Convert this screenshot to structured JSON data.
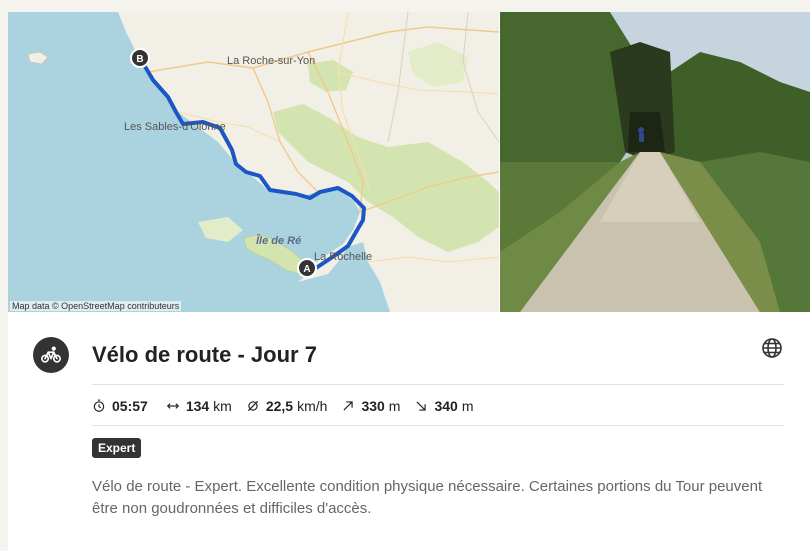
{
  "map": {
    "attribution": "Map data © OpenStreetMap contributeurs",
    "labels": {
      "city_north": "La Roche-sur-Yon",
      "city_west": "Les Sables-d'Olonne",
      "city_south": "La Rochelle",
      "island": "Île de Ré"
    },
    "markers": {
      "start": "A",
      "end": "B"
    }
  },
  "activity": {
    "title": "Vélo de route - Jour 7",
    "icon": "road-bike-icon"
  },
  "stats": {
    "duration": "05:57",
    "distance_value": "134",
    "distance_unit": "km",
    "speed_value": "22,5",
    "speed_unit": "km/h",
    "elevation_up_value": "330",
    "elevation_up_unit": "m",
    "elevation_down_value": "340",
    "elevation_down_unit": "m"
  },
  "badge": "Expert",
  "description": "Vélo de route - Expert. Excellente condition physique nécessaire. Certaines portions du Tour peuvent être non goudronnées et difficiles d'accès.",
  "colors": {
    "route": "#1a56c4",
    "sea": "#aad3df",
    "land": "#f2efe6",
    "park": "#d3e4b0"
  }
}
